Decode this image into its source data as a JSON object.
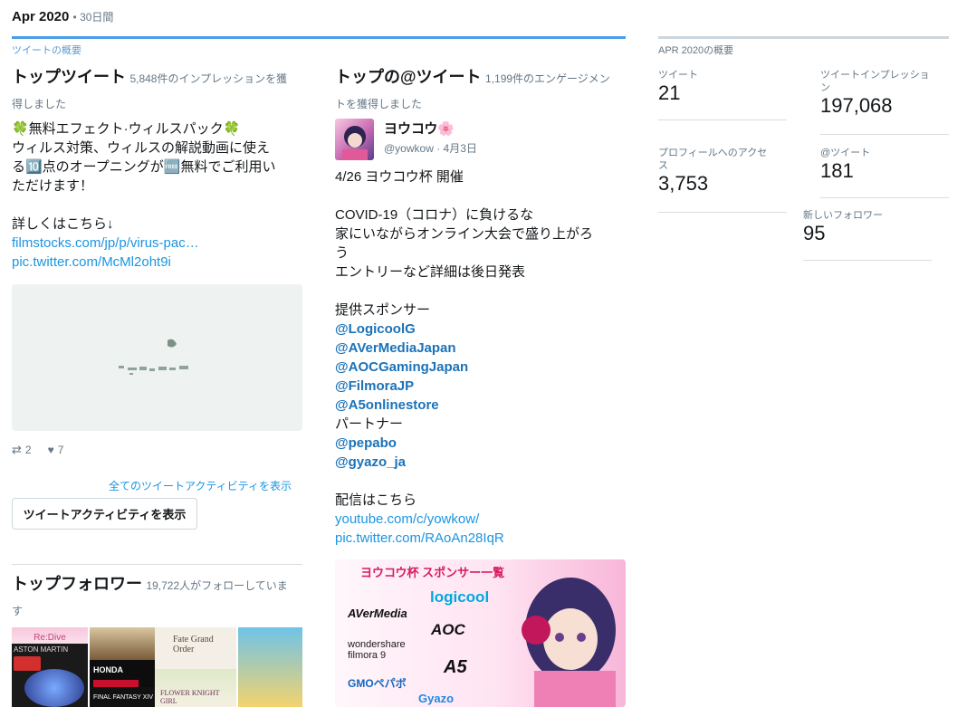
{
  "header": {
    "period": "Apr 2020",
    "duration": "• 30日間"
  },
  "top_tweet": {
    "section_label": "ツイートの概要",
    "title": "トップツイート",
    "impressions_text": "5,848件のインプレッションを獲",
    "impressions_text2": "得しました",
    "text_line1": "🍀無料エフェクト·ウィルスパック🍀",
    "text_line2": "ウィルス対策、ウィルスの解説動画に使え",
    "text_line3": "る🔟点のオープニングが🆓無料でご利用い",
    "text_line4": "ただけます！",
    "text_line5": "詳しくはこちら↓",
    "link1": "filmstocks.com/jp/p/virus-pac…",
    "link2": "pic.twitter.com/McMl2oht9i",
    "retweets": "2",
    "likes": "7",
    "all_activity_link": "全てのツイートアクティビティを表示",
    "view_activity_button": "ツイートアクティビティを表示"
  },
  "top_mention": {
    "title": "トップの@ツイート",
    "engagement_text": "1,199件のエンゲージメン",
    "engagement_text2": "トを獲得しました",
    "author_name": "ヨウコウ🌸",
    "author_handle": "@yowkow",
    "date": "· 4月3日",
    "line1": "4/26 ヨウコウ杯 開催",
    "line2": "COVID-19（コロナ）に負けるな",
    "line3": "家にいながらオンライン大会で盛り上がろ",
    "line4": "う",
    "line5": "エントリーなど詳細は後日発表",
    "line6": "提供スポンサー",
    "mentions": [
      "@LogicoolG",
      "@AVerMediaJapan",
      "@AOCGamingJapan",
      "@FilmoraJP",
      "@A5onlinestore"
    ],
    "partner_label": "パートナー",
    "partners": [
      "@pepabo",
      "@gyazo_ja"
    ],
    "stream_label": "配信はこちら",
    "link1": "youtube.com/c/yowkow/",
    "link2": "pic.twitter.com/RAoAn28IqR",
    "banner": {
      "title": "ヨウコウ杯 スポンサー一覧",
      "logos": [
        "logicool",
        "AVerMedia",
        "AOC",
        "wondershare filmora 9",
        "GMOペパボ",
        "A5",
        "Gyazo"
      ]
    }
  },
  "top_followers": {
    "title": "トップフォロワー",
    "count_text": "19,722人がフォローしていま",
    "count_text2": "す",
    "tiles": [
      "Re:Dive",
      "ASTON MARTIN",
      "HONDA",
      "Fate Grand Order",
      "FINAL FANTASY XIV",
      "FLOWER KNIGHT GIRL"
    ]
  },
  "summary": {
    "label": "APR 2020の概要",
    "metrics": [
      {
        "label": "ツイート",
        "value": "21"
      },
      {
        "label": "ツイートインプレッショ\nン",
        "value": "197,068"
      },
      {
        "label": "プロフィールへのアクセ\nス",
        "value": "3,753"
      },
      {
        "label": "@ツイート",
        "value": "181"
      },
      {
        "label": "新しいフォロワー",
        "value": "95"
      }
    ]
  },
  "colors": {
    "accent": "#4a9ee6",
    "link": "#1b95e0",
    "mention": "#1b72b8"
  }
}
